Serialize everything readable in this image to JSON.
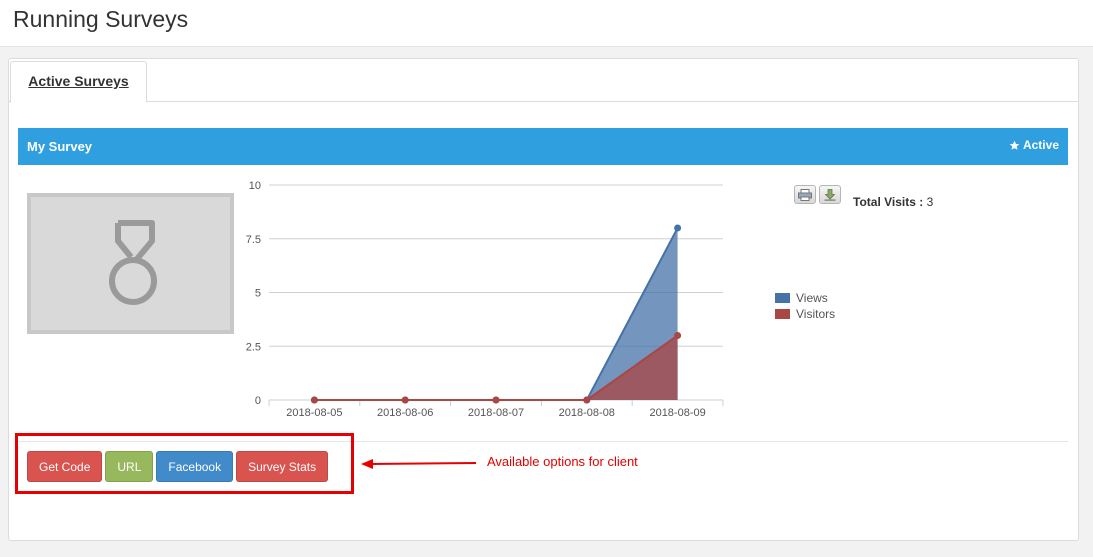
{
  "page": {
    "title": "Running Surveys"
  },
  "tabs": [
    {
      "label": "Active Surveys",
      "active": true
    }
  ],
  "survey": {
    "name": "My Survey",
    "status": "Active"
  },
  "stats": {
    "total_visits_label": "Total Visits :",
    "total_visits_value": "3"
  },
  "chart_data": {
    "type": "area",
    "categories": [
      "2018-08-05",
      "2018-08-06",
      "2018-08-07",
      "2018-08-08",
      "2018-08-09"
    ],
    "yticks": [
      "0",
      "2.5",
      "5",
      "7.5",
      "10"
    ],
    "ylim": [
      0,
      10
    ],
    "series": [
      {
        "name": "Views",
        "color": "#4572a7",
        "values": [
          0,
          0,
          0,
          0,
          8
        ]
      },
      {
        "name": "Visitors",
        "color": "#aa4643",
        "values": [
          0,
          0,
          0,
          0,
          3
        ]
      }
    ],
    "legend_position": "right"
  },
  "actions": [
    {
      "label": "Get Code",
      "style": "red"
    },
    {
      "label": "URL",
      "style": "green"
    },
    {
      "label": "Facebook",
      "style": "blue"
    },
    {
      "label": "Survey Stats",
      "style": "red"
    }
  ],
  "annotation": {
    "text": "Available options for client",
    "color": "#e60000"
  },
  "colors": {
    "header": "#2f9fe0",
    "highlight": "#e60000"
  },
  "icons": {
    "status": "star-icon",
    "print": "print-icon",
    "download": "download-icon",
    "thumbnail": "medal-icon"
  }
}
